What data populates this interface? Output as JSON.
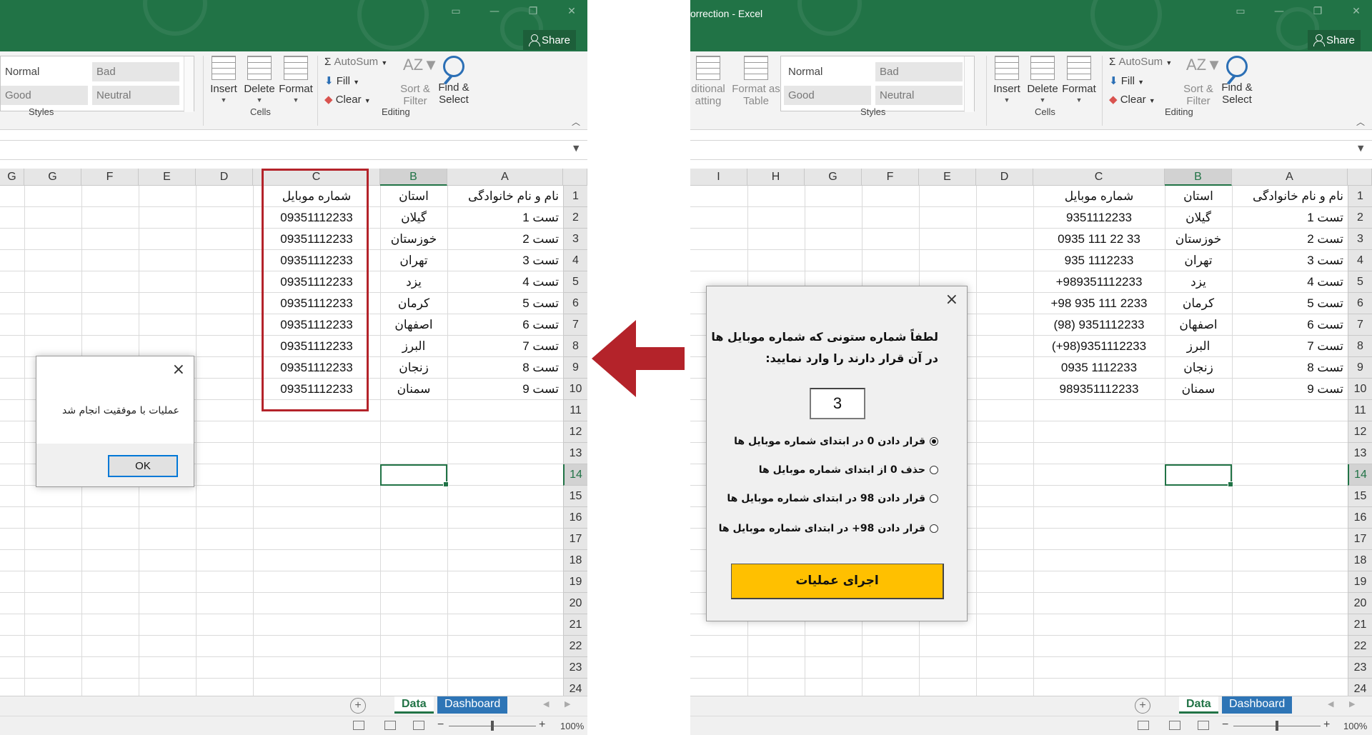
{
  "left": {
    "window": {
      "share_label": "Share"
    },
    "ribbon": {
      "styles": {
        "normal": "Normal",
        "bad": "Bad",
        "good": "Good",
        "neutral": "Neutral",
        "group_label": "Styles"
      },
      "cells": {
        "insert": "Insert",
        "delete": "Delete",
        "format": "Format",
        "group_label": "Cells"
      },
      "editing": {
        "autosum": "AutoSum",
        "fill": "Fill",
        "clear": "Clear",
        "sort": "Sort &",
        "filter": "Filter",
        "find": "Find &",
        "select": "Select",
        "group_label": "Editing"
      }
    },
    "sheet": {
      "columns": [
        "G",
        "F",
        "E",
        "D",
        "C",
        "B",
        "A"
      ],
      "headers": {
        "a": "نام و نام خانوادگی",
        "b": "استان",
        "c": "شماره موبایل"
      },
      "rows": [
        {
          "a": "تست 1",
          "b": "گیلان",
          "c": "09351112233"
        },
        {
          "a": "تست 2",
          "b": "خوزستان",
          "c": "09351112233"
        },
        {
          "a": "تست 3",
          "b": "تهران",
          "c": "09351112233"
        },
        {
          "a": "تست 4",
          "b": "یزد",
          "c": "09351112233"
        },
        {
          "a": "تست 5",
          "b": "کرمان",
          "c": "09351112233"
        },
        {
          "a": "تست 6",
          "b": "اصفهان",
          "c": "09351112233"
        },
        {
          "a": "تست 7",
          "b": "البرز",
          "c": "09351112233"
        },
        {
          "a": "تست 8",
          "b": "زنجان",
          "c": "09351112233"
        },
        {
          "a": "تست 9",
          "b": "سمنان",
          "c": "09351112233"
        }
      ],
      "row_numbers": [
        "1",
        "2",
        "3",
        "4",
        "5",
        "6",
        "7",
        "8",
        "9",
        "10",
        "11",
        "12",
        "13",
        "14",
        "15",
        "16",
        "17",
        "18",
        "19",
        "20",
        "21",
        "22",
        "23",
        "24"
      ]
    },
    "tabs": {
      "data": "Data",
      "dashboard": "Dashboard"
    },
    "status": {
      "zoom": "100%"
    },
    "message": {
      "text": "عملیات با موفقیت انجام شد",
      "ok": "OK"
    }
  },
  "right": {
    "window": {
      "title": "orrection - Excel",
      "share_label": "Share"
    },
    "ribbon": {
      "conditional": {
        "line1": "ditional",
        "line2": "atting"
      },
      "format_table": {
        "line1": "Format as",
        "line2": "Table"
      },
      "styles": {
        "normal": "Normal",
        "bad": "Bad",
        "good": "Good",
        "neutral": "Neutral",
        "group_label": "Styles"
      },
      "cells": {
        "insert": "Insert",
        "delete": "Delete",
        "format": "Format",
        "group_label": "Cells"
      },
      "editing": {
        "autosum": "AutoSum",
        "fill": "Fill",
        "clear": "Clear",
        "sort": "Sort &",
        "filter": "Filter",
        "find": "Find &",
        "select": "Select",
        "group_label": "Editing"
      }
    },
    "sheet": {
      "columns": [
        "I",
        "H",
        "G",
        "F",
        "E",
        "D",
        "C",
        "B",
        "A"
      ],
      "headers": {
        "a": "نام و نام خانوادگی",
        "b": "استان",
        "c": "شماره موبایل"
      },
      "rows": [
        {
          "a": "تست 1",
          "b": "گیلان",
          "c": "9351112233"
        },
        {
          "a": "تست 2",
          "b": "خوزستان",
          "c": "0935 111 22 33"
        },
        {
          "a": "تست 3",
          "b": "تهران",
          "c": "935 1112233"
        },
        {
          "a": "تست 4",
          "b": "یزد",
          "c": "+989351112233"
        },
        {
          "a": "تست 5",
          "b": "کرمان",
          "c": "+98 935 111 2233"
        },
        {
          "a": "تست 6",
          "b": "اصفهان",
          "c": "(98) 9351112233"
        },
        {
          "a": "تست 7",
          "b": "البرز",
          "c": "(+98)9351112233"
        },
        {
          "a": "تست 8",
          "b": "زنجان",
          "c": "0935   1112233"
        },
        {
          "a": "تست 9",
          "b": "سمنان",
          "c": "989351112233"
        }
      ],
      "row_numbers": [
        "1",
        "2",
        "3",
        "4",
        "5",
        "6",
        "7",
        "8",
        "9",
        "10",
        "11",
        "12",
        "13",
        "14",
        "15",
        "16",
        "17",
        "18",
        "19",
        "20",
        "21",
        "22",
        "23",
        "24"
      ]
    },
    "tabs": {
      "data": "Data",
      "dashboard": "Dashboard"
    },
    "status": {
      "zoom": "100%"
    },
    "form": {
      "prompt_line1": "لطفاً شماره ستونی که شماره موبایل ها",
      "prompt_line2": "در آن قرار دارند را وارد نمایید:",
      "column_value": "3",
      "options": [
        {
          "label": "قرار دادن 0 در ابتدای شماره موبایل ها",
          "selected": true
        },
        {
          "label": "حذف 0 از ابتدای شماره موبایل ها",
          "selected": false
        },
        {
          "label": "قرار دادن 98 در ابتدای شماره موبایل ها",
          "selected": false
        },
        {
          "label": "قرار دادن 98+ در ابتدای شماره موبایل ها",
          "selected": false
        }
      ],
      "run_label": "اجرای عملیات"
    }
  },
  "colors": {
    "excel_green": "#217346",
    "arrow_red": "#b4232a",
    "run_button": "#ffc000",
    "dashboard_tab": "#2e75b6"
  }
}
